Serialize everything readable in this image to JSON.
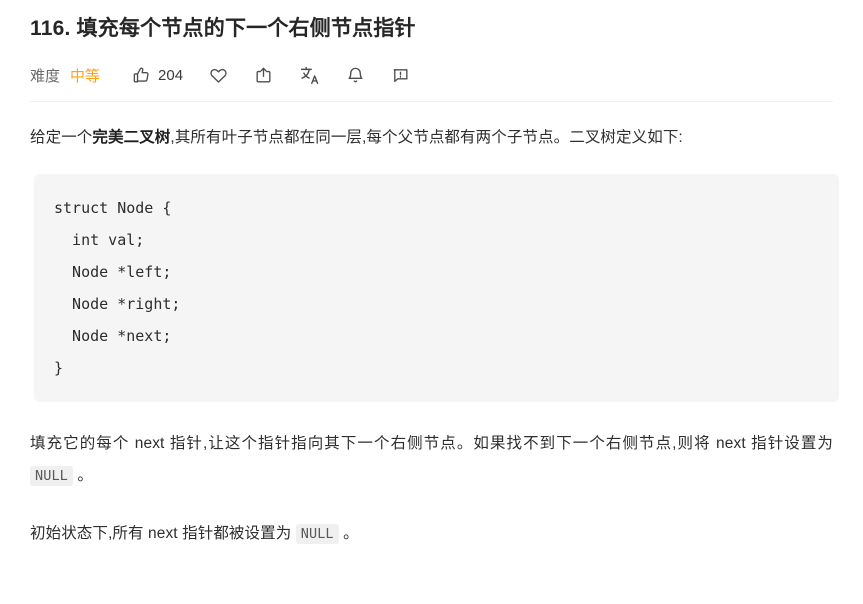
{
  "problem": {
    "title": "116. 填充每个节点的下一个右侧节点指针",
    "difficulty_label": "难度",
    "difficulty_value": "中等"
  },
  "toolbar": {
    "like": {
      "icon": "thumbs-up-icon",
      "count": "204"
    },
    "favorite": {
      "icon": "heart-icon"
    },
    "share": {
      "icon": "share-icon"
    },
    "translate": {
      "icon": "translate-icon"
    },
    "notify": {
      "icon": "bell-icon"
    },
    "feedback": {
      "icon": "feedback-icon"
    }
  },
  "content": {
    "p1_part1": "给定一个",
    "p1_bold": "完美二叉树",
    "p1_part2": ",其所有叶子节点都在同一层,每个父节点都有两个子节点。二叉树定义如下:",
    "code": "struct Node {\n  int val;\n  Node *left;\n  Node *right;\n  Node *next;\n}",
    "p2_part1": "填充它的每个 next 指针,让这个指针指向其下一个右侧节点。如果找不到下一个右侧节点,则将 next 指针设置为 ",
    "p2_code": "NULL",
    "p2_part2": " 。",
    "p3_part1": "初始状态下,所有 next 指针都被设置为 ",
    "p3_code": "NULL",
    "p3_part2": " 。"
  },
  "colors": {
    "difficulty_medium": "#ffa116",
    "code_background": "#f5f5f5",
    "inline_code_background": "#f0f0f0",
    "text": "#262626"
  }
}
